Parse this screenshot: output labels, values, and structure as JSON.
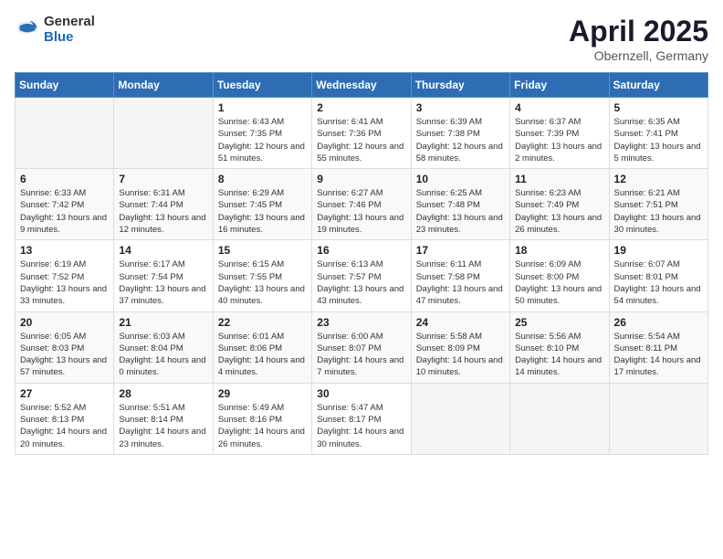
{
  "header": {
    "logo_general": "General",
    "logo_blue": "Blue",
    "month_title": "April 2025",
    "subtitle": "Obernzell, Germany"
  },
  "days_of_week": [
    "Sunday",
    "Monday",
    "Tuesday",
    "Wednesday",
    "Thursday",
    "Friday",
    "Saturday"
  ],
  "weeks": [
    [
      {
        "day": "",
        "text": ""
      },
      {
        "day": "",
        "text": ""
      },
      {
        "day": "1",
        "text": "Sunrise: 6:43 AM\nSunset: 7:35 PM\nDaylight: 12 hours and 51 minutes."
      },
      {
        "day": "2",
        "text": "Sunrise: 6:41 AM\nSunset: 7:36 PM\nDaylight: 12 hours and 55 minutes."
      },
      {
        "day": "3",
        "text": "Sunrise: 6:39 AM\nSunset: 7:38 PM\nDaylight: 12 hours and 58 minutes."
      },
      {
        "day": "4",
        "text": "Sunrise: 6:37 AM\nSunset: 7:39 PM\nDaylight: 13 hours and 2 minutes."
      },
      {
        "day": "5",
        "text": "Sunrise: 6:35 AM\nSunset: 7:41 PM\nDaylight: 13 hours and 5 minutes."
      }
    ],
    [
      {
        "day": "6",
        "text": "Sunrise: 6:33 AM\nSunset: 7:42 PM\nDaylight: 13 hours and 9 minutes."
      },
      {
        "day": "7",
        "text": "Sunrise: 6:31 AM\nSunset: 7:44 PM\nDaylight: 13 hours and 12 minutes."
      },
      {
        "day": "8",
        "text": "Sunrise: 6:29 AM\nSunset: 7:45 PM\nDaylight: 13 hours and 16 minutes."
      },
      {
        "day": "9",
        "text": "Sunrise: 6:27 AM\nSunset: 7:46 PM\nDaylight: 13 hours and 19 minutes."
      },
      {
        "day": "10",
        "text": "Sunrise: 6:25 AM\nSunset: 7:48 PM\nDaylight: 13 hours and 23 minutes."
      },
      {
        "day": "11",
        "text": "Sunrise: 6:23 AM\nSunset: 7:49 PM\nDaylight: 13 hours and 26 minutes."
      },
      {
        "day": "12",
        "text": "Sunrise: 6:21 AM\nSunset: 7:51 PM\nDaylight: 13 hours and 30 minutes."
      }
    ],
    [
      {
        "day": "13",
        "text": "Sunrise: 6:19 AM\nSunset: 7:52 PM\nDaylight: 13 hours and 33 minutes."
      },
      {
        "day": "14",
        "text": "Sunrise: 6:17 AM\nSunset: 7:54 PM\nDaylight: 13 hours and 37 minutes."
      },
      {
        "day": "15",
        "text": "Sunrise: 6:15 AM\nSunset: 7:55 PM\nDaylight: 13 hours and 40 minutes."
      },
      {
        "day": "16",
        "text": "Sunrise: 6:13 AM\nSunset: 7:57 PM\nDaylight: 13 hours and 43 minutes."
      },
      {
        "day": "17",
        "text": "Sunrise: 6:11 AM\nSunset: 7:58 PM\nDaylight: 13 hours and 47 minutes."
      },
      {
        "day": "18",
        "text": "Sunrise: 6:09 AM\nSunset: 8:00 PM\nDaylight: 13 hours and 50 minutes."
      },
      {
        "day": "19",
        "text": "Sunrise: 6:07 AM\nSunset: 8:01 PM\nDaylight: 13 hours and 54 minutes."
      }
    ],
    [
      {
        "day": "20",
        "text": "Sunrise: 6:05 AM\nSunset: 8:03 PM\nDaylight: 13 hours and 57 minutes."
      },
      {
        "day": "21",
        "text": "Sunrise: 6:03 AM\nSunset: 8:04 PM\nDaylight: 14 hours and 0 minutes."
      },
      {
        "day": "22",
        "text": "Sunrise: 6:01 AM\nSunset: 8:06 PM\nDaylight: 14 hours and 4 minutes."
      },
      {
        "day": "23",
        "text": "Sunrise: 6:00 AM\nSunset: 8:07 PM\nDaylight: 14 hours and 7 minutes."
      },
      {
        "day": "24",
        "text": "Sunrise: 5:58 AM\nSunset: 8:09 PM\nDaylight: 14 hours and 10 minutes."
      },
      {
        "day": "25",
        "text": "Sunrise: 5:56 AM\nSunset: 8:10 PM\nDaylight: 14 hours and 14 minutes."
      },
      {
        "day": "26",
        "text": "Sunrise: 5:54 AM\nSunset: 8:11 PM\nDaylight: 14 hours and 17 minutes."
      }
    ],
    [
      {
        "day": "27",
        "text": "Sunrise: 5:52 AM\nSunset: 8:13 PM\nDaylight: 14 hours and 20 minutes."
      },
      {
        "day": "28",
        "text": "Sunrise: 5:51 AM\nSunset: 8:14 PM\nDaylight: 14 hours and 23 minutes."
      },
      {
        "day": "29",
        "text": "Sunrise: 5:49 AM\nSunset: 8:16 PM\nDaylight: 14 hours and 26 minutes."
      },
      {
        "day": "30",
        "text": "Sunrise: 5:47 AM\nSunset: 8:17 PM\nDaylight: 14 hours and 30 minutes."
      },
      {
        "day": "",
        "text": ""
      },
      {
        "day": "",
        "text": ""
      },
      {
        "day": "",
        "text": ""
      }
    ]
  ]
}
